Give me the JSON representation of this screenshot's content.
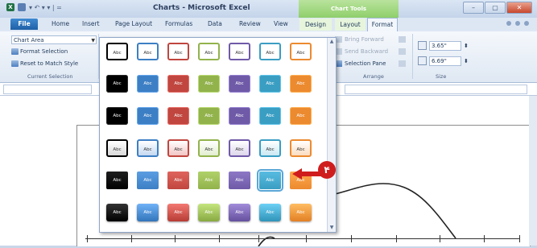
{
  "window": {
    "title": "Charts - Microsoft Excel",
    "contextual_group": "Chart Tools",
    "controls": [
      "–",
      "▢",
      "✕"
    ]
  },
  "qat": {
    "app_letter": "X",
    "more": "▾ ↶ ▾ ▾ | ="
  },
  "tabs": {
    "file": "File",
    "home": "Home",
    "insert": "Insert",
    "page_layout": "Page Layout",
    "formulas": "Formulas",
    "data": "Data",
    "review": "Review",
    "view": "View",
    "design": "Design",
    "layout": "Layout",
    "format": "Format"
  },
  "ribbon": {
    "chart_element": "Chart Area",
    "format_selection": "Format Selection",
    "reset_match_style": "Reset to Match Style",
    "current_selection_label": "Current Selection",
    "bring_forward": "Bring Forward",
    "send_backward": "Send Backward",
    "selection_pane": "Selection Pane",
    "arrange_label": "Arrange",
    "height_value": "3.65\"",
    "width_value": "6.69\"",
    "size_label": "Size"
  },
  "gallery": {
    "swatch_text": "Abc",
    "colors": [
      "#000000",
      "#3d7fc4",
      "#c0463f",
      "#92b34c",
      "#6f5aa8",
      "#3a9ec3",
      "#ec8a2f"
    ],
    "light_colors": [
      "#d9d9d9",
      "#c5d9f1",
      "#f2c6c4",
      "#e2eed0",
      "#ddd6ec",
      "#cbe8f3",
      "#fbdcc0"
    ],
    "selected_row": 4,
    "selected_col": 5
  },
  "callout": {
    "badge": "۴"
  }
}
